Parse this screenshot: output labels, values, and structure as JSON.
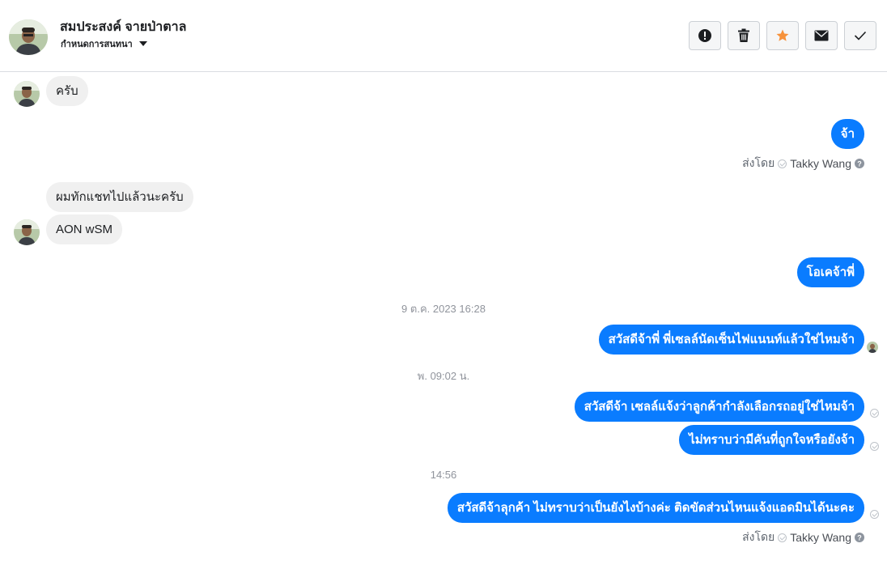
{
  "header": {
    "name": "สมประสงค์ จายป่าตาล",
    "subtitle": "กำหนดการสนทนา",
    "actions": [
      {
        "name": "report",
        "icon": "alert-icon"
      },
      {
        "name": "delete",
        "icon": "trash-icon"
      },
      {
        "name": "star",
        "icon": "star-icon"
      },
      {
        "name": "mark-unread",
        "icon": "envelope-icon"
      },
      {
        "name": "done",
        "icon": "check-icon"
      }
    ]
  },
  "messages": [
    {
      "dir": "in",
      "text": "ครับ"
    },
    {
      "dir": "out",
      "text": "จ้า"
    },
    {
      "sent_by_label": "ส่งโดย",
      "sent_by_name": "Takky Wang"
    },
    {
      "dir": "in",
      "text": "ผมทักแชทไปแล้วนะครับ"
    },
    {
      "dir": "in",
      "text": "AON wSM"
    },
    {
      "dir": "out",
      "text": "โอเคจ้าพี่"
    },
    {
      "timestamp": "9 ต.ค. 2023 16:28"
    },
    {
      "dir": "out",
      "text": "สวัสดีจ้าพี่ พี่เซลล์นัดเซ็นไฟแนนท์แล้วใช่ไหมจ้า"
    },
    {
      "timestamp": "พ. 09:02 น."
    },
    {
      "dir": "out",
      "text": "สวัสดีจ้า เซลล์แจ้งว่าลูกค้ากำลังเลือกรถอยู่ใช่ไหมจ้า"
    },
    {
      "dir": "out",
      "text": "ไม่ทราบว่ามีคันที่ถูกใจหรือยังจ้า"
    },
    {
      "timestamp": "14:56"
    },
    {
      "dir": "out",
      "text": "สวัสดีจ้าลุกค้า ไม่ทราบว่าเป็นยังไงบ้างค่ะ ติดขัดส่วนไหนแจ้งแอดมินได้นะคะ"
    },
    {
      "sent_by_label": "ส่งโดย",
      "sent_by_name": "Takky Wang"
    }
  ],
  "colors": {
    "outgoing_bubble": "#0a7cff",
    "incoming_bubble": "#f0f0f0",
    "star": "#f7923b"
  }
}
